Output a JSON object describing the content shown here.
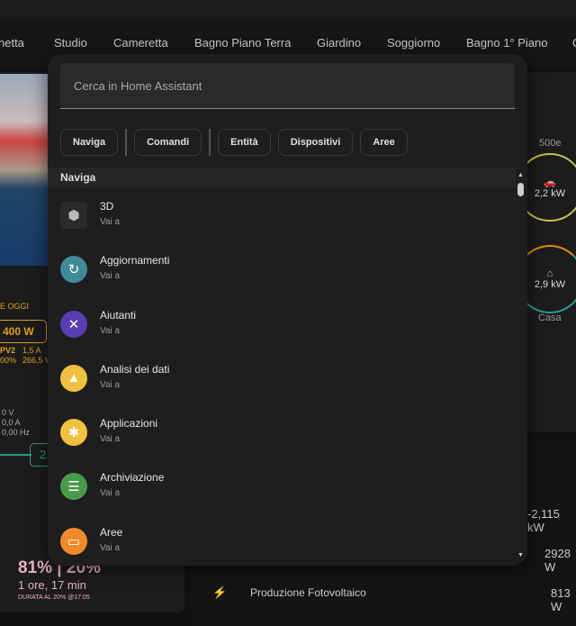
{
  "tabs": [
    "netta",
    "Studio",
    "Cameretta",
    "Bagno Piano Terra",
    "Giardino",
    "Soggiorno",
    "Bagno 1° Piano",
    "C"
  ],
  "background": {
    "left": {
      "oggi": "E OGGI",
      "power": "400 W",
      "pv2": "PV2",
      "pv2_pct": "00%",
      "current": "1,5 A",
      "voltage": "266,5 V",
      "v2": "0 V",
      "a2": "0,0 A",
      "hz": "0,00 Hz",
      "box2": "2",
      "battery_pct": "81% | 20%",
      "duration": "1 ore, 17 min",
      "duration_label": "DURATA AL 20% @17:05"
    },
    "right": {
      "car_label": "500e",
      "car_power": "2,2 kW",
      "home_power": "2,9 kW",
      "home_label": "Casa",
      "rows": [
        {
          "label": "",
          "value": "-2,115 kW"
        },
        {
          "label": "",
          "value": "2928 W"
        },
        {
          "label": "Produzione Fotovoltaico",
          "value": "813 W"
        }
      ]
    }
  },
  "dialog": {
    "search_placeholder": "Cerca in Home Assistant",
    "chips": [
      "Naviga",
      "Comandi",
      "Entità",
      "Dispositivi",
      "Aree"
    ],
    "section": "Naviga",
    "items": [
      {
        "title": "3D",
        "subtitle": "Vai a",
        "icon": "3d-cube-icon",
        "color": "#2a2a2a"
      },
      {
        "title": "Aggiornamenti",
        "subtitle": "Vai a",
        "icon": "update-icon",
        "color": "#3e8a96"
      },
      {
        "title": "Aiutanti",
        "subtitle": "Vai a",
        "icon": "tools-icon",
        "color": "#5a3db0"
      },
      {
        "title": "Analisi dei dati",
        "subtitle": "Vai a",
        "icon": "shapes-icon",
        "color": "#f0c040"
      },
      {
        "title": "Applicazioni",
        "subtitle": "Vai a",
        "icon": "puzzle-icon",
        "color": "#f0c040"
      },
      {
        "title": "Archiviazione",
        "subtitle": "Vai a",
        "icon": "database-icon",
        "color": "#4a9a4a"
      },
      {
        "title": "Aree",
        "subtitle": "Vai a",
        "icon": "sofa-icon",
        "color": "#ef8a2a"
      }
    ]
  }
}
